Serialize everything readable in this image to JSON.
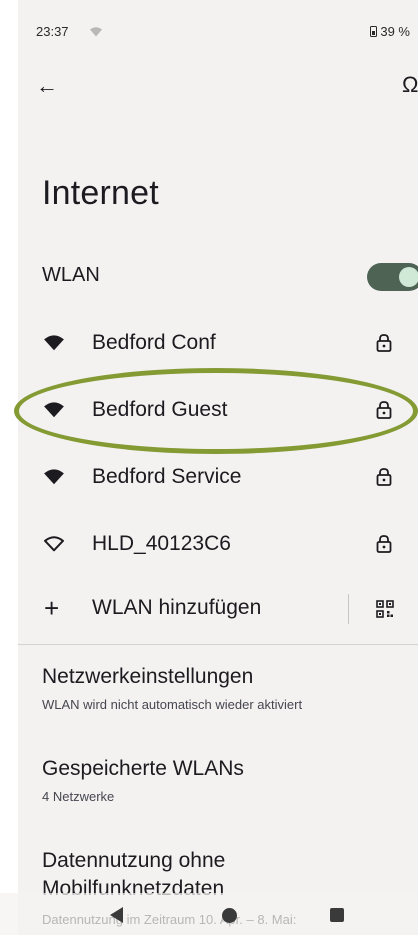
{
  "status_bar": {
    "time": "23:37",
    "battery": "39 %"
  },
  "header": {
    "title": "Internet"
  },
  "wlan": {
    "label": "WLAN",
    "enabled": true
  },
  "networks": [
    {
      "name": "Bedford Conf",
      "locked": true,
      "signal": "full"
    },
    {
      "name": "Bedford Guest",
      "locked": true,
      "signal": "full",
      "highlighted": true
    },
    {
      "name": "Bedford Service",
      "locked": true,
      "signal": "full"
    },
    {
      "name": "HLD_40123C6",
      "locked": true,
      "signal": "outline"
    }
  ],
  "add_network": {
    "label": "WLAN hinzufügen"
  },
  "preferences": [
    {
      "title": "Netzwerkeinstellungen",
      "subtitle": "WLAN wird nicht automatisch wieder aktiviert"
    },
    {
      "title": "Gespeicherte WLANs",
      "subtitle": "4 Netzwerke"
    },
    {
      "title": "Datennutzung ohne Mobilfunknetzdaten",
      "title_line2": "Mobilfunknetzdaten",
      "subtitle": "Datennutzung im Zeitraum 10. Apr. – 8. Mai:"
    }
  ],
  "colors": {
    "accent_toggle": "#4f6355",
    "highlight_ring": "#849a33",
    "background": "#f4f2f1"
  },
  "icons": [
    "wifi-icon",
    "lock-icon",
    "back-arrow-icon",
    "plus-icon",
    "qr-code-icon"
  ]
}
